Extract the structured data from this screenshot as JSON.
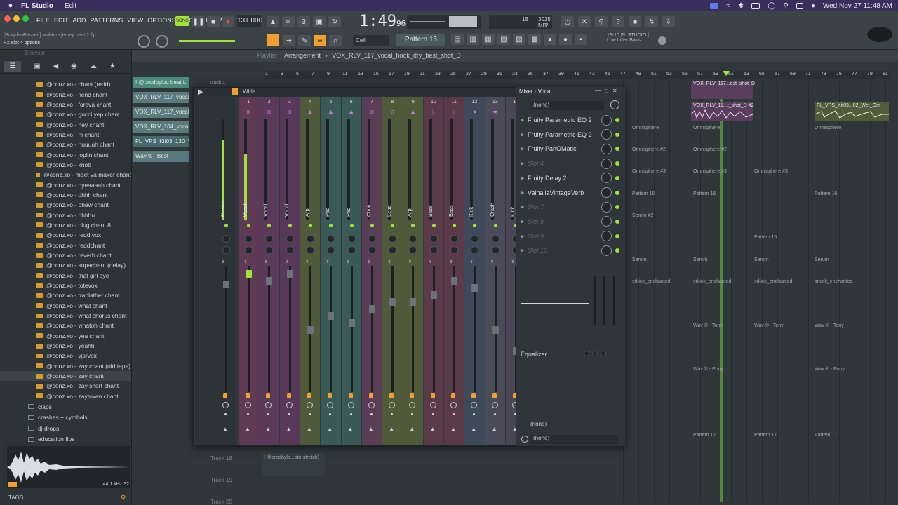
{
  "macbar": {
    "app": "FL Studio",
    "menu": [
      "Edit"
    ],
    "datetime": "Wed Nov 27  11:48 AM"
  },
  "fl_menu": [
    "FILE",
    "EDIT",
    "ADD",
    "PATTERNS",
    "VIEW",
    "OPTIONS",
    "TOOLS",
    "HELP"
  ],
  "transport": {
    "mode": "SONG",
    "tempo": "131.000",
    "time": "1:49",
    "time_small": "96",
    "cpu": "18",
    "mem": "3015 MB",
    "poly": "2"
  },
  "project": {
    "name": "[BraydenBassett] ambient jersey beat 2.flp",
    "hint": "FX slot 4 options"
  },
  "pattern": {
    "label": "Pattern 15",
    "snap": "Cell"
  },
  "news": {
    "line1": "19-10  FL STUDIO |",
    "line2": "Low Lifter Bass"
  },
  "browser": {
    "title": "Browser",
    "items": [
      "@conz.xo - chant (redd)",
      "@conz.xo - fiend chant",
      "@conz.xo - foreva chant",
      "@conz.xo - gucci yep chant",
      "@conz.xo - hey chant",
      "@conz.xo - hi chant",
      "@conz.xo - huuuuh chant",
      "@conz.xo - joplin chant",
      "@conz.xo - knob",
      "@conz.xo - meet ya maker chant",
      "@conz.xo - nyeaaaah chant",
      "@conz.xo - ohhh chant",
      "@conz.xo - phew chant",
      "@conz.xo - phhhu",
      "@conz.xo - plug chant 8",
      "@conz.xo - redd vox",
      "@conz.xo - reddchant",
      "@conz.xo - reverb chant",
      "@conz.xo - supachant (delay)",
      "@conz.xo - that girl aye",
      "@conz.xo - totevox",
      "@conz.xo - traplather chant",
      "@conz.xo - what chant",
      "@conz.xo - what chorus chant",
      "@conz.xo - whatoh chant",
      "@conz.xo - yea chant",
      "@conz.xo - yeahh",
      "@conz.xo - yjsrvox",
      "@conz.xo - zay chant (old tape)",
      "@conz.xo - zay chant",
      "@conz.xo - zay short chant",
      "@conz.xo - zaytoven chant"
    ],
    "folders": [
      "claps",
      "crashes + cymbals",
      "dj drops",
      "education flps"
    ],
    "sample_info": "44.1 kHz 32",
    "tags": "TAGS"
  },
  "channel_rack": [
    "! @prodbyloq beat t..",
    "VOX_RLV_117_vocal..",
    "VOX_RLV_117_vocal..",
    "VOX_RLV_104_vocal..",
    "FL_VPS_Kit03_130_V..",
    "Wav ® - Best"
  ],
  "playlist": {
    "title": "Playlist",
    "crumb": "Arrangement",
    "arrow": "›",
    "pattern": "VOX_RLV_117_vocal_hook_dry_best_shot_D",
    "bars": [
      "1",
      "3",
      "5",
      "7",
      "9",
      "11",
      "13",
      "15",
      "17",
      "19",
      "21",
      "23",
      "25",
      "27",
      "29",
      "31",
      "33",
      "35",
      "37",
      "39",
      "41",
      "43",
      "45",
      "47",
      "49",
      "51",
      "53",
      "55",
      "57",
      "59",
      "61",
      "63",
      "65",
      "67",
      "69",
      "71",
      "73",
      "75",
      "77",
      "79",
      "81"
    ],
    "tracks": [
      "Track 1",
      "Track 18",
      "Track 19",
      "Track 20"
    ],
    "clips": [
      {
        "t": "VOX_RLV_117...est_shot_D"
      },
      {
        "t": "VOX_RLV_11...t_shot_D #2"
      },
      {
        "t": "FL_VPS_Kit03...02_Wet_Gm"
      },
      {
        "t": "Omnisphere"
      },
      {
        "t": "Omnisphere #2"
      },
      {
        "t": "Omnisphere #3"
      },
      {
        "t": "Pattern 16"
      },
      {
        "t": "Serum #2"
      },
      {
        "t": "Pattern 15"
      },
      {
        "t": "Serum"
      },
      {
        "t": "srkick_enchanted"
      },
      {
        "t": "Wav ® - Tony"
      },
      {
        "t": "Wav ® - Pony"
      },
      {
        "t": "Pattern 17"
      },
      {
        "t": "! @prodbylo...oto-stretch)"
      }
    ]
  },
  "mixer": {
    "title": "Mixer - Vocal",
    "preset": "Wide",
    "channels": [
      {
        "n": "",
        "label": "Master"
      },
      {
        "n": "1",
        "label": "Vocal"
      },
      {
        "n": "2",
        "label": "Vocal"
      },
      {
        "n": "3",
        "label": "Vocal"
      },
      {
        "n": "4",
        "label": "Arp"
      },
      {
        "n": "5",
        "label": "Pad"
      },
      {
        "n": "6",
        "label": "Pad"
      },
      {
        "n": "7",
        "label": "Choir"
      },
      {
        "n": "8",
        "label": "Lead"
      },
      {
        "n": "9",
        "label": "Arp"
      },
      {
        "n": "10",
        "label": "Bass"
      },
      {
        "n": "11",
        "label": "Bass"
      },
      {
        "n": "12",
        "label": "Kick"
      },
      {
        "n": "13",
        "label": "Crash"
      },
      {
        "n": "14",
        "label": "Kick"
      }
    ],
    "scale": [
      "3",
      "0",
      "3",
      "6",
      "9"
    ]
  },
  "fx": {
    "input": "(none)",
    "slots": [
      "Fruity Parametric EQ 2",
      "Fruity Parametric EQ 2",
      "Fruity PanOMatic",
      "Slot 4",
      "Fruity Delay 2",
      "ValhallaVintageVerb",
      "Slot 7",
      "Slot 8",
      "Slot 9",
      "Slot 10"
    ],
    "eq": "Equalizer",
    "out1": "(none)",
    "out2": "(none)"
  },
  "colors": {
    "accent": "#9fe23a",
    "menubar": "#3a2e5c",
    "orange": "#f0a030"
  }
}
